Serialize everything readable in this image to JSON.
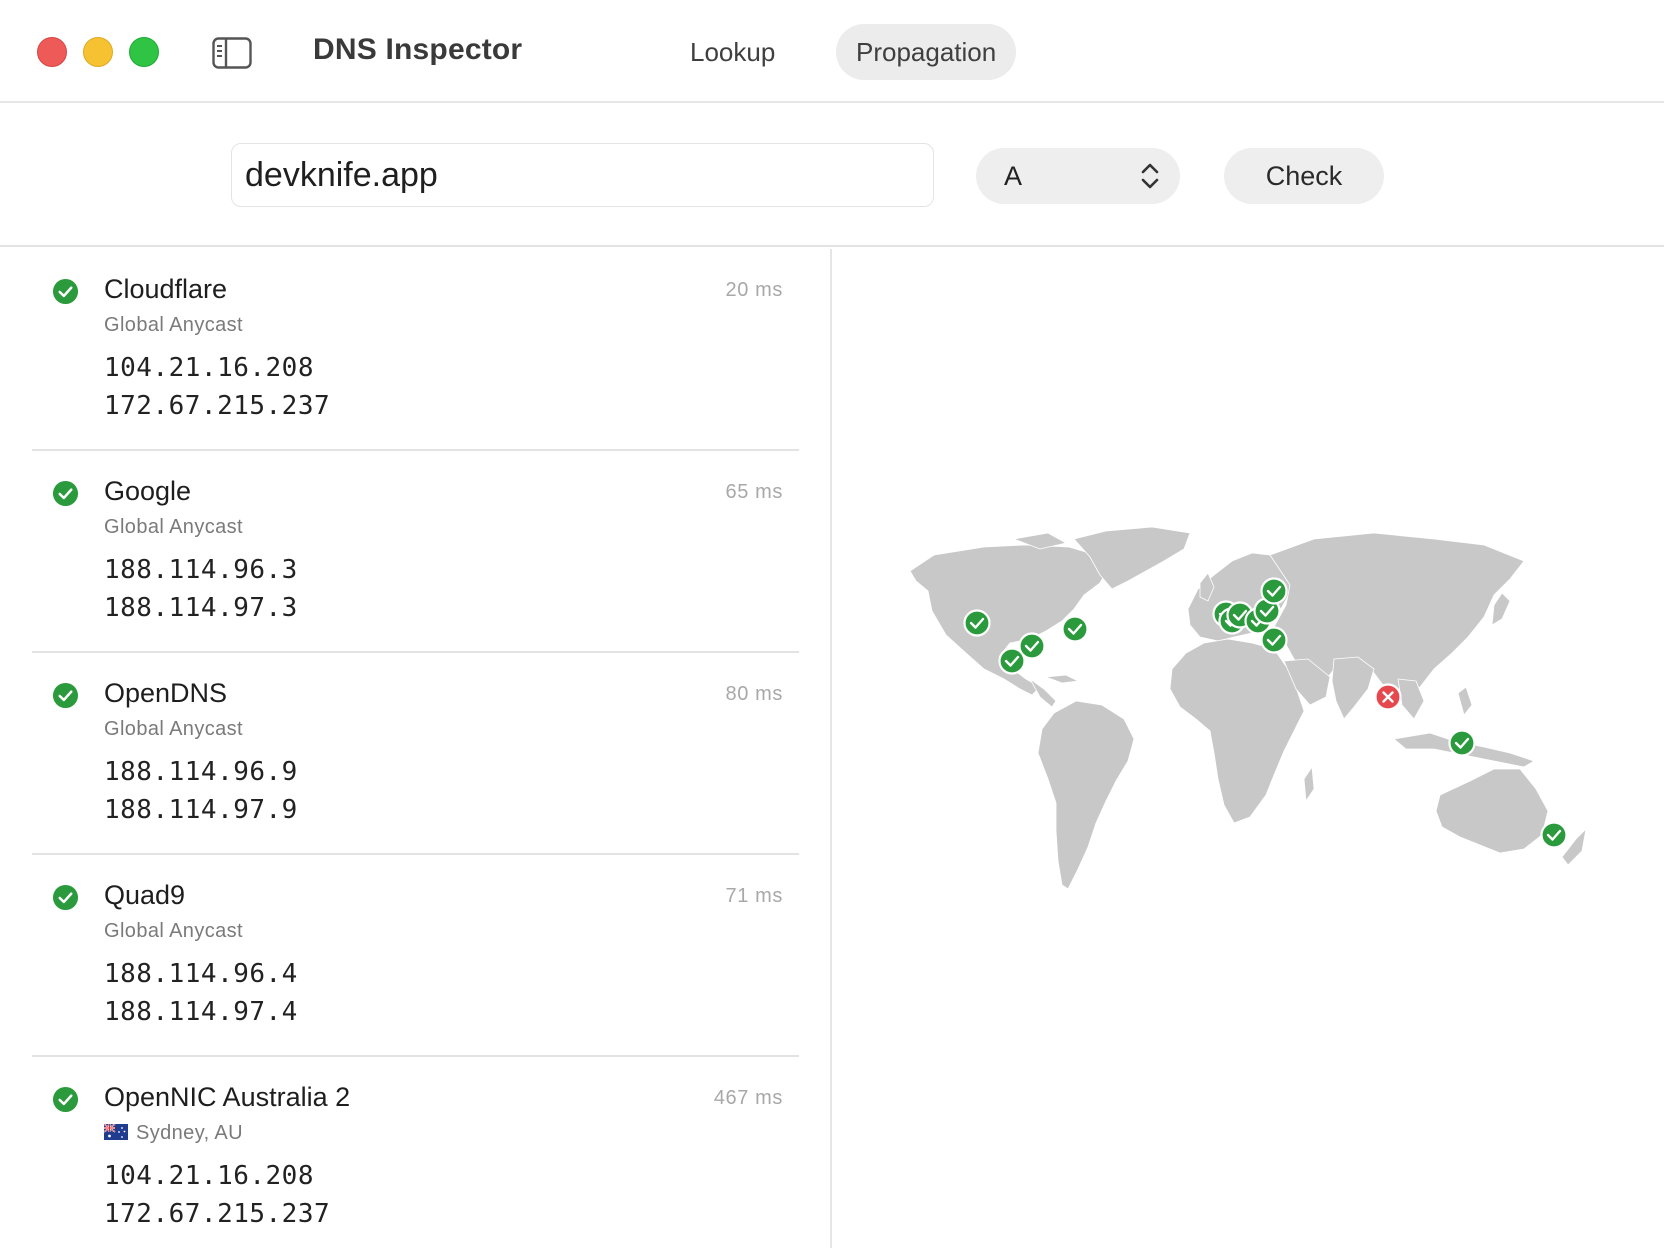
{
  "window": {
    "title": "DNS Inspector",
    "tabs": [
      {
        "label": "Lookup",
        "active": false
      },
      {
        "label": "Propagation",
        "active": true
      }
    ]
  },
  "toolbar": {
    "domain_value": "devknife.app",
    "record_type": "A",
    "check_label": "Check"
  },
  "resolvers": [
    {
      "name": "Cloudflare",
      "location": "Global Anycast",
      "latency": "20 ms",
      "status": "ok",
      "ips": [
        "104.21.16.208",
        "172.67.215.237"
      ]
    },
    {
      "name": "Google",
      "location": "Global Anycast",
      "latency": "65 ms",
      "status": "ok",
      "ips": [
        "188.114.96.3",
        "188.114.97.3"
      ]
    },
    {
      "name": "OpenDNS",
      "location": "Global Anycast",
      "latency": "80 ms",
      "status": "ok",
      "ips": [
        "188.114.96.9",
        "188.114.97.9"
      ]
    },
    {
      "name": "Quad9",
      "location": "Global Anycast",
      "latency": "71 ms",
      "status": "ok",
      "ips": [
        "188.114.96.4",
        "188.114.97.4"
      ]
    },
    {
      "name": "OpenNIC Australia 2",
      "location": "Sydney, AU",
      "flag": "AU",
      "latency": "467 ms",
      "status": "ok",
      "ips": [
        "104.21.16.208",
        "172.67.215.237"
      ]
    }
  ],
  "map": {
    "markers_ok": 14,
    "markers_failed": 1
  },
  "colors": {
    "ok": "#2a9a3c",
    "failed": "#e5484d",
    "land": "#c8c8c8",
    "close": "#ee5a57",
    "minimize": "#f6c232",
    "maximize": "#2fc444"
  }
}
